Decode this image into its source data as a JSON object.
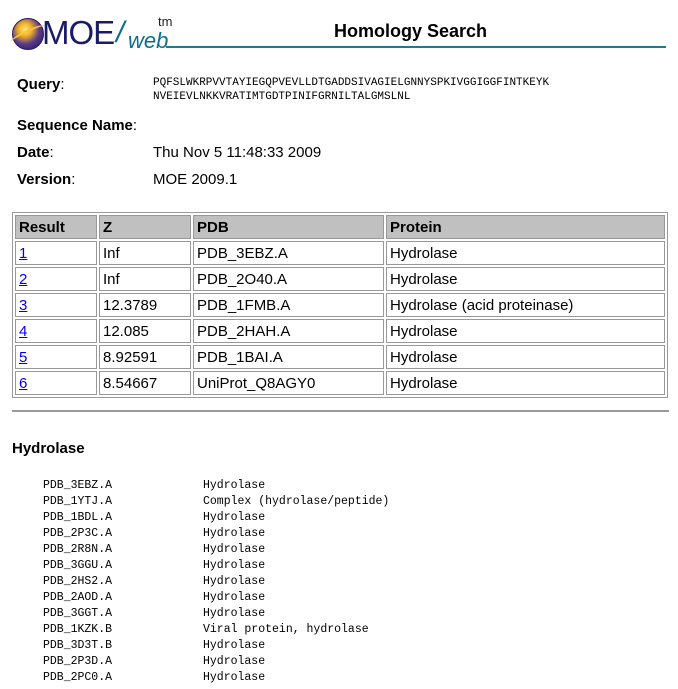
{
  "header": {
    "logo_main": "MOE",
    "logo_slash": "/",
    "logo_sub": "web",
    "logo_tm": "tm",
    "title": "Homology Search"
  },
  "meta": {
    "query_label": "Query",
    "sequence": "PQFSLWKRPVVTAYIEGQPVEVLLDTGADDSIVAGIELGNNYSPKIVGGIGGFINTKEYK NVEIEVLNKKVRATIMTGDTPINIFGRNILTALGMSLNL",
    "seqname_label": "Sequence Name",
    "seqname_value": "",
    "date_label": "Date",
    "date_value": "Thu Nov 5 11:48:33 2009",
    "version_label": "Version",
    "version_value": "MOE 2009.1",
    "colon": ":"
  },
  "results": {
    "headers": [
      "Result",
      "Z",
      "PDB",
      "Protein"
    ],
    "rows": [
      {
        "result": "1",
        "z": "Inf",
        "pdb": "PDB_3EBZ.A",
        "protein": "Hydrolase"
      },
      {
        "result": "2",
        "z": "Inf",
        "pdb": "PDB_2O40.A",
        "protein": "Hydrolase"
      },
      {
        "result": "3",
        "z": "12.3789",
        "pdb": "PDB_1FMB.A",
        "protein": "Hydrolase (acid proteinase)"
      },
      {
        "result": "4",
        "z": "12.085",
        "pdb": "PDB_2HAH.A",
        "protein": "Hydrolase"
      },
      {
        "result": "5",
        "z": "8.92591",
        "pdb": "PDB_1BAI.A",
        "protein": "Hydrolase"
      },
      {
        "result": "6",
        "z": "8.54667",
        "pdb": "UniProt_Q8AGY0",
        "protein": "Hydrolase"
      }
    ]
  },
  "section": {
    "title": "Hydrolase",
    "hits": [
      {
        "id": "PDB_3EBZ.A",
        "desc": "Hydrolase"
      },
      {
        "id": "PDB_1YTJ.A",
        "desc": "Complex (hydrolase/peptide)"
      },
      {
        "id": "PDB_1BDL.A",
        "desc": "Hydrolase"
      },
      {
        "id": "PDB_2P3C.A",
        "desc": "Hydrolase"
      },
      {
        "id": "PDB_2R8N.A",
        "desc": "Hydrolase"
      },
      {
        "id": "PDB_3GGU.A",
        "desc": "Hydrolase"
      },
      {
        "id": "PDB_2HS2.A",
        "desc": "Hydrolase"
      },
      {
        "id": "PDB_2AOD.A",
        "desc": "Hydrolase"
      },
      {
        "id": "PDB_3GGT.A",
        "desc": "Hydrolase"
      },
      {
        "id": "PDB_1KZK.B",
        "desc": "Viral protein, hydrolase"
      },
      {
        "id": "PDB_3D3T.B",
        "desc": "Hydrolase"
      },
      {
        "id": "PDB_2P3D.A",
        "desc": "Hydrolase"
      },
      {
        "id": "PDB_2PC0.A",
        "desc": "Hydrolase"
      }
    ]
  },
  "colors": {
    "accent_rule": "#1b7a8c",
    "header_bg": "#c0c0c0",
    "link": "#0000ee"
  }
}
